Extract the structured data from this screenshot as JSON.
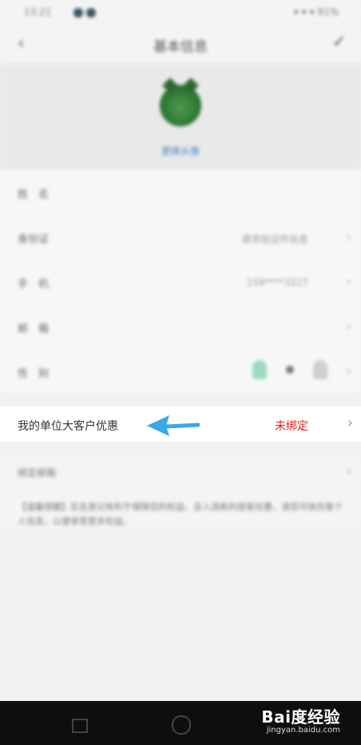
{
  "status_bar": {
    "time": "13:21",
    "right": "▾ ▾ ▾ 91%"
  },
  "nav": {
    "title": "基本信息",
    "back_icon": "‹",
    "confirm_icon": "✓"
  },
  "profile": {
    "change_avatar_label": "更换头像"
  },
  "info_rows": [
    {
      "label": "姓　名",
      "value": ""
    },
    {
      "label": "身份证",
      "value": "请添加证件信息"
    },
    {
      "label": "手　机",
      "value": "159****3227"
    },
    {
      "label": "邮　箱",
      "value": ""
    },
    {
      "label": "性　别",
      "value": ""
    }
  ],
  "highlight_row": {
    "label": "我的单位大客户优惠",
    "status": "未绑定",
    "status_color": "#e02020"
  },
  "section2": {
    "label": "绑定邮箱",
    "note": "【温馨提醒】实名登记有利于保障您的权益，且入选新的旅客优惠，请您尽快完善个人信息，以便享受更多权益。"
  },
  "watermark": {
    "brand": "Bai度经验",
    "url": "jingyan.baidu.com"
  },
  "arrow_color": "#3aa8e6"
}
